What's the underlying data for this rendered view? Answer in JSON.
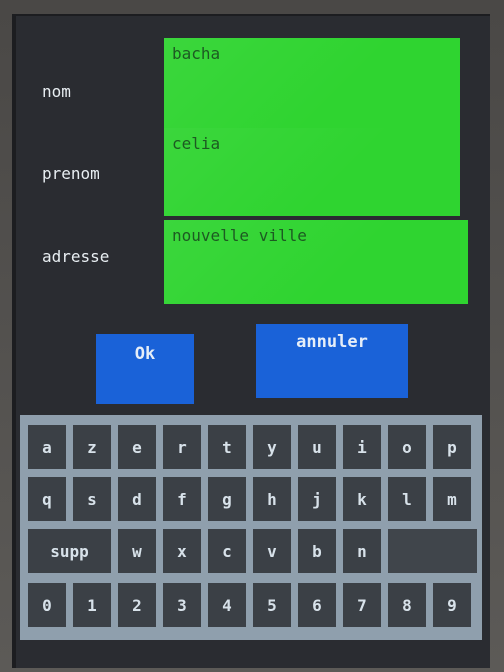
{
  "form": {
    "fields": [
      {
        "label": "nom",
        "value": "bacha"
      },
      {
        "label": "prenom",
        "value": "celia"
      },
      {
        "label": "adresse",
        "value": "nouvelle ville"
      }
    ],
    "ok_label": "Ok",
    "cancel_label": "annuler"
  },
  "keyboard": {
    "rows": [
      [
        "a",
        "z",
        "e",
        "r",
        "t",
        "y",
        "u",
        "i",
        "o",
        "p"
      ],
      [
        "q",
        "s",
        "d",
        "f",
        "g",
        "h",
        "j",
        "k",
        "l",
        "m"
      ],
      [
        "supp",
        "w",
        "x",
        "c",
        "v",
        "b",
        "n",
        ""
      ],
      [
        "0",
        "1",
        "2",
        "3",
        "4",
        "5",
        "6",
        "7",
        "8",
        "9"
      ]
    ]
  },
  "colors": {
    "field_bg": "#2fd430",
    "button_bg": "#1a62d8",
    "screen_bg": "#2a2c31",
    "keyboard_bg": "#8f9fad",
    "key_bg": "#3b4046"
  }
}
